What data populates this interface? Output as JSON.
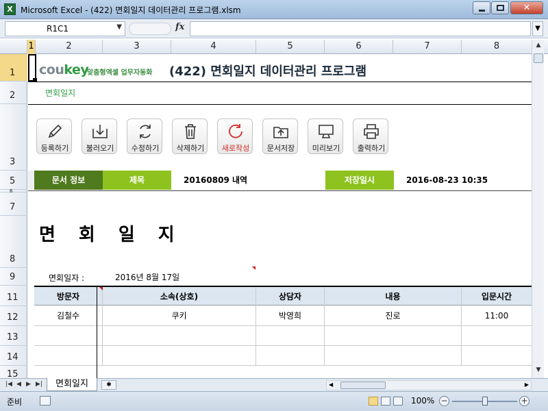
{
  "window": {
    "title": "Microsoft Excel - (422) 면회일지 데이터관리 프로그램.xlsm",
    "app_icon": "excel-icon"
  },
  "formula_bar": {
    "name_box": "R1C1",
    "fx_label": "fx",
    "formula": ""
  },
  "columns": [
    "1",
    "2",
    "3",
    "4",
    "5",
    "6",
    "7",
    "8"
  ],
  "rows": [
    "1",
    "2",
    "3",
    "5",
    "6",
    "7",
    "8",
    "9",
    "11",
    "12",
    "13",
    "14",
    "15"
  ],
  "sheet": {
    "logo_prefix": "cou",
    "logo_suffix": "key",
    "tagline": "맞춤형엑셀 업무자동화",
    "title": "(422) 면회일지 데이터관리 프로그램",
    "sheet_label": "면회일지",
    "toolbar": [
      {
        "label": "등록하기",
        "icon": "pencil-icon"
      },
      {
        "label": "불러오기",
        "icon": "download-icon"
      },
      {
        "label": "수정하기",
        "icon": "refresh-icon"
      },
      {
        "label": "삭제하기",
        "icon": "trash-icon"
      },
      {
        "label": "새로작성",
        "icon": "new-icon",
        "color": "#d02b25"
      },
      {
        "label": "문서저장",
        "icon": "upload-folder-icon"
      },
      {
        "label": "미리보기",
        "icon": "monitor-icon"
      },
      {
        "label": "출력하기",
        "icon": "printer-icon"
      }
    ],
    "info": {
      "section_label": "문서 정보",
      "title_label": "제목",
      "title_value": "20160809 내역",
      "saved_label": "저장일시",
      "saved_value": "2016-08-23 10:35",
      "colors": {
        "dark_green": "#4f7a1e",
        "light_green": "#8dc21f"
      }
    },
    "form_title": "면회일지",
    "date_label": "면회일자 :",
    "date_value": "2016년 8월 17일",
    "table": {
      "headers": [
        "방문자",
        "소속(상호)",
        "상담자",
        "내용",
        "입문시간"
      ],
      "rows": [
        [
          "김철수",
          "쿠키",
          "박영희",
          "진로",
          "11:00"
        ],
        [
          "",
          "",
          "",
          "",
          ""
        ],
        [
          "",
          "",
          "",
          "",
          ""
        ]
      ]
    }
  },
  "tabs": {
    "active": "면회일지"
  },
  "status": {
    "text": "준비",
    "zoom": "100%"
  }
}
